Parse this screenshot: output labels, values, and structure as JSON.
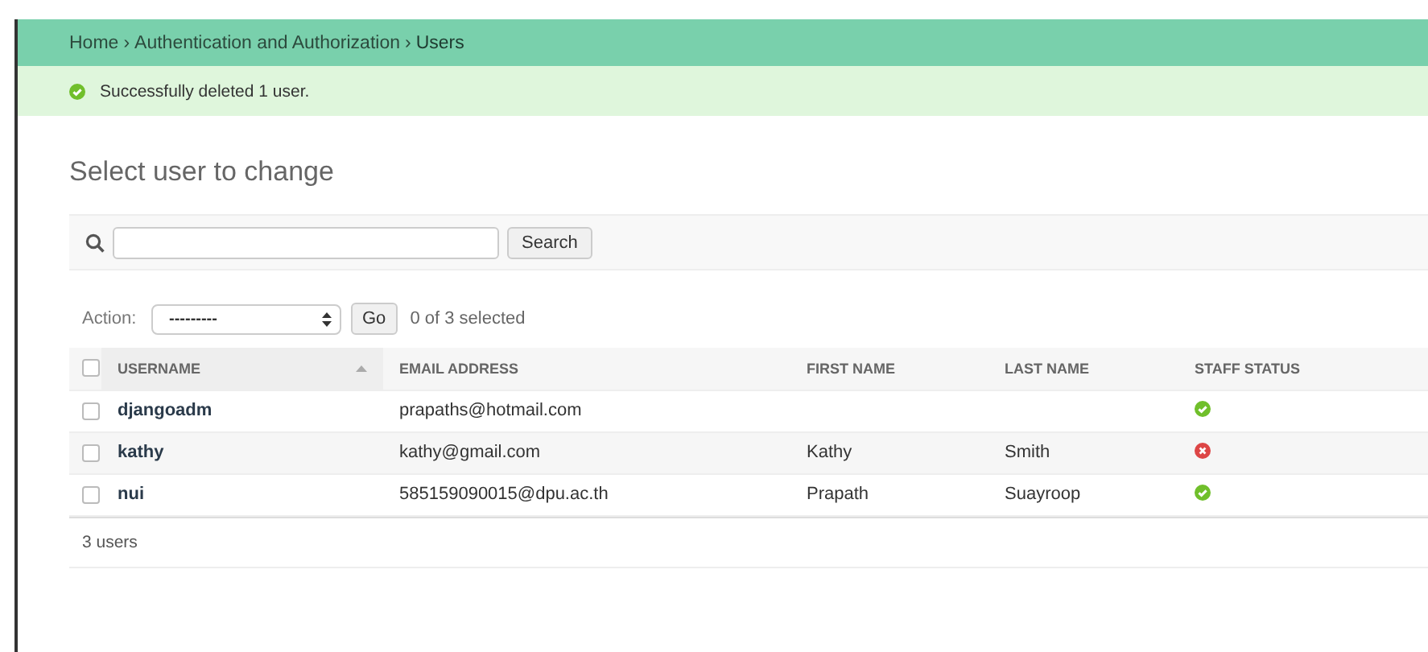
{
  "breadcrumbs": [
    {
      "kind": "link",
      "text": "Home"
    },
    {
      "kind": "separator",
      "text": "›"
    },
    {
      "kind": "link",
      "text": "Authentication and Authorization"
    },
    {
      "kind": "separator",
      "text": "›"
    },
    {
      "kind": "current",
      "text": "Users"
    }
  ],
  "message": {
    "kind": "success",
    "text": "Successfully deleted 1 user."
  },
  "title": "Select user to change",
  "search": {
    "button": "Search"
  },
  "actions": {
    "label": "Action:",
    "value": "---------",
    "button": "Go",
    "counter": "0 of 3 selected"
  },
  "table": {
    "select_all_checked": false,
    "columns": [
      {
        "label": "USERNAME",
        "sorted": true
      },
      {
        "label": "EMAIL ADDRESS",
        "sorted": false
      },
      {
        "label": "FIRST NAME",
        "sorted": false
      },
      {
        "label": "LAST NAME",
        "sorted": false
      },
      {
        "label": "STAFF STATUS",
        "sorted": false
      }
    ],
    "rows": [
      {
        "checked": false,
        "username": "djangoadm",
        "email": "prapaths@hotmail.com",
        "staff": true
      },
      {
        "checked": false,
        "username": "kathy",
        "email": "kathy@gmail.com",
        "first_name": "Kathy",
        "last_name": "Smith",
        "staff": false
      },
      {
        "checked": false,
        "username": "nui",
        "email": "585159090015@dpu.ac.th",
        "first_name": "Prapath",
        "last_name": "Suayroop",
        "staff": true
      }
    ]
  },
  "paginator": "3 users"
}
